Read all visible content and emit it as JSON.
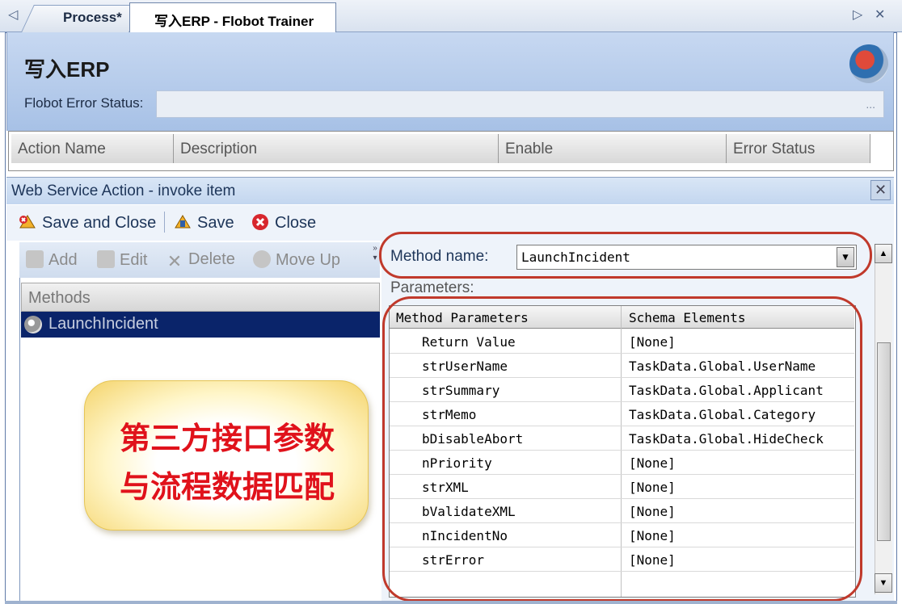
{
  "tabs": [
    {
      "label": "Process*"
    },
    {
      "label": "写入ERP - Flobot Trainer"
    }
  ],
  "tab_nav": {
    "left": "◁",
    "right": "▷",
    "close": "✕"
  },
  "header": {
    "title": "写入ERP",
    "error_status_label": "Flobot Error Status:",
    "error_status_value": "",
    "ellipsis": "..."
  },
  "action_grid": {
    "columns": [
      "Action Name",
      "Description",
      "Enable",
      "Error Status"
    ]
  },
  "sub_window": {
    "title": "Web Service Action - invoke item",
    "close": "✕",
    "toolbar": [
      {
        "label": "Save and Close",
        "icon": "save-close-icon"
      },
      {
        "label": "Save",
        "icon": "save-icon"
      },
      {
        "label": "Close",
        "icon": "close-circle-icon"
      }
    ]
  },
  "methods_panel": {
    "toolbar": [
      {
        "label": "Add",
        "icon": "add-icon"
      },
      {
        "label": "Edit",
        "icon": "edit-icon"
      },
      {
        "label": "Delete",
        "icon": "delete-icon"
      },
      {
        "label": "Move Up",
        "icon": "move-up-icon"
      }
    ],
    "header": "Methods",
    "items": [
      {
        "label": "LaunchIncident",
        "selected": true
      }
    ]
  },
  "callout": {
    "line1": "第三方接口参数",
    "line2": "与流程数据匹配"
  },
  "method_config": {
    "method_name_label": "Method name:",
    "method_name_value": "LaunchIncident",
    "combo_arrow": "▼",
    "parameters_label": "Parameters:",
    "columns": [
      "Method Parameters",
      "Schema Elements"
    ],
    "rows": [
      {
        "param": "Return Value",
        "schema": "[None]"
      },
      {
        "param": "strUserName",
        "schema": "TaskData.Global.UserName"
      },
      {
        "param": "strSummary",
        "schema": "TaskData.Global.Applicant"
      },
      {
        "param": "strMemo",
        "schema": "TaskData.Global.Category"
      },
      {
        "param": "bDisableAbort",
        "schema": "TaskData.Global.HideCheck"
      },
      {
        "param": "nPriority",
        "schema": "[None]"
      },
      {
        "param": "strXML",
        "schema": "[None]"
      },
      {
        "param": "bValidateXML",
        "schema": "[None]"
      },
      {
        "param": "nIncidentNo",
        "schema": "[None]"
      },
      {
        "param": "strError",
        "schema": "[None]"
      }
    ]
  },
  "scrollbar": {
    "up": "▲",
    "down": "▼"
  },
  "colors": {
    "selection": "#0a246a",
    "annotation": "#c0392b",
    "callout_text": "#e0121b",
    "header_bg": "#b7cdec"
  }
}
